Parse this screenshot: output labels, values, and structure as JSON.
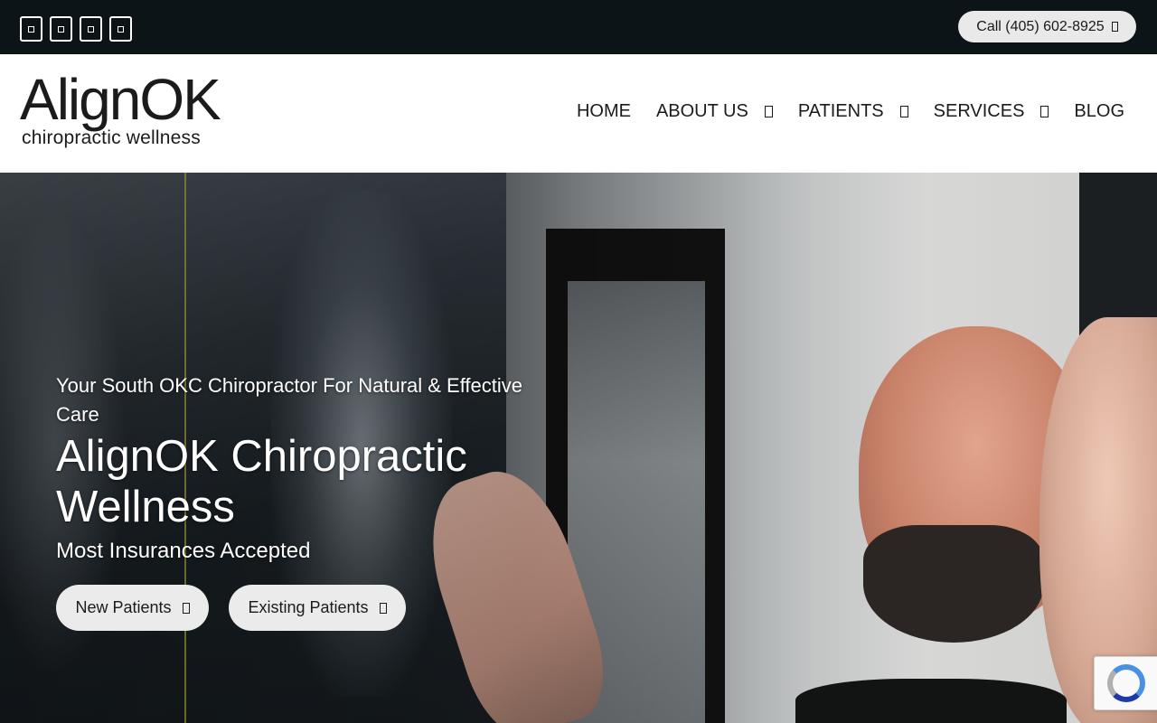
{
  "topbar": {
    "social_icons": [
      "social-icon-1",
      "social-icon-2",
      "social-icon-3",
      "social-icon-4"
    ],
    "call_label": "Call (405) 602-8925"
  },
  "logo": {
    "main": "AlignOK",
    "sub": "chiropractic wellness"
  },
  "nav": {
    "items": [
      {
        "label": "HOME",
        "has_dropdown": false
      },
      {
        "label": "ABOUT US",
        "has_dropdown": true
      },
      {
        "label": "PATIENTS",
        "has_dropdown": true
      },
      {
        "label": "SERVICES",
        "has_dropdown": true
      },
      {
        "label": "BLOG",
        "has_dropdown": false
      }
    ]
  },
  "hero": {
    "tagline": "Your South OKC Chiropractor For Natural & Effective Care",
    "title": "AlignOK Chiropractic Wellness",
    "subtitle": "Most Insurances Accepted",
    "buttons": {
      "new_patients": "New Patients",
      "existing_patients": "Existing Patients"
    }
  },
  "colors": {
    "topbar_bg": "#0c1418",
    "header_bg": "#ffffff",
    "button_bg": "#ebebeb",
    "text_dark": "#1b1b1b"
  }
}
